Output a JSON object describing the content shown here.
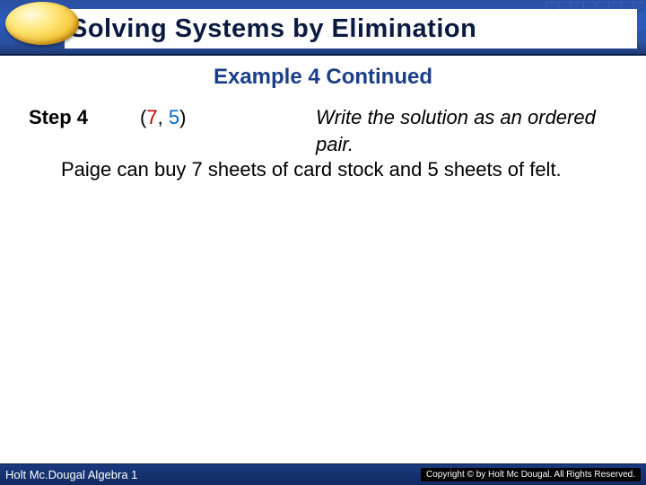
{
  "header": {
    "title": "Solving Systems by Elimination"
  },
  "section_heading": "Example 4 Continued",
  "body": {
    "step_label": "Step 4",
    "pair_open": "(",
    "pair_a": "7",
    "pair_comma": ", ",
    "pair_b": "5",
    "pair_close": ")",
    "instruction": "Write the solution as an ordered pair.",
    "sentence": "Paige can buy 7 sheets of card stock and 5 sheets of felt."
  },
  "footer": {
    "left": "Holt Mc.Dougal Algebra 1",
    "right": "Copyright © by Holt Mc Dougal. All Rights Reserved."
  }
}
